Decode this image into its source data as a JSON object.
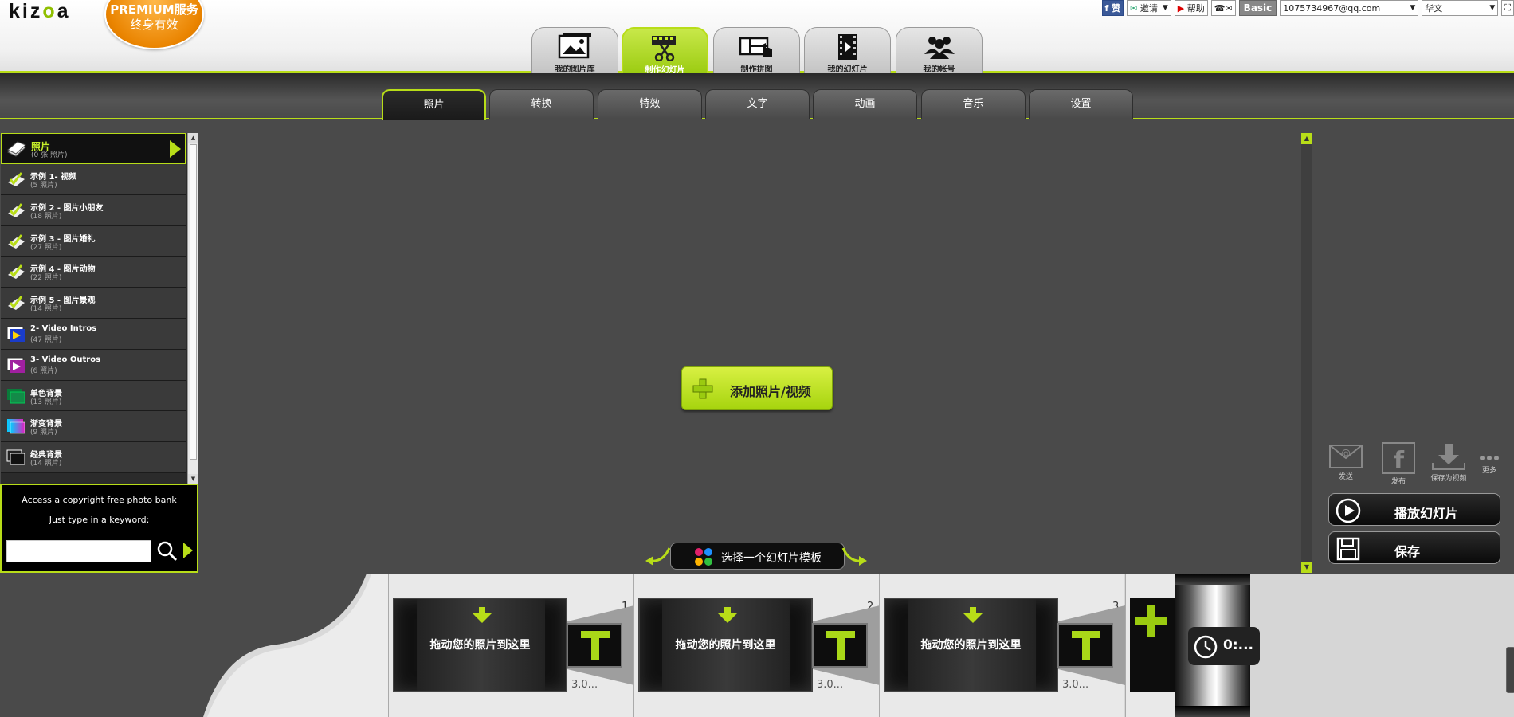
{
  "header": {
    "logo_text": "kizoa",
    "premium_line1": "PREMIUM服务",
    "premium_line2": "终身有效",
    "main_tabs": [
      {
        "label": "我的图片库"
      },
      {
        "label": "制作幻灯片",
        "active": true
      },
      {
        "label": "制作拼图"
      },
      {
        "label": "我的幻灯片"
      },
      {
        "label": "我的帐号"
      }
    ],
    "topright": {
      "fb_label": "赞",
      "invite_label": "邀请",
      "help_label": "帮助",
      "account_type": "Basic",
      "email": "1075734967@qq.com",
      "language": "华文"
    }
  },
  "sub_tabs": [
    "照片",
    "转换",
    "特效",
    "文字",
    "动画",
    "音乐",
    "设置"
  ],
  "left_panel": {
    "items": [
      {
        "name": "照片",
        "count": "(0 张 照片)",
        "icon": "photos-icon"
      },
      {
        "name": "示例 1- 视频",
        "count": "(5 照片)",
        "icon": "album-check-icon"
      },
      {
        "name": "示例 2 - 图片小朋友",
        "count": "(18 照片)",
        "icon": "album-check-icon"
      },
      {
        "name": "示例 3 - 图片婚礼",
        "count": "(27 照片)",
        "icon": "album-check-icon"
      },
      {
        "name": "示例 4 - 图片动物",
        "count": "(22 照片)",
        "icon": "album-check-icon"
      },
      {
        "name": "示例 5 - 图片景观",
        "count": "(14 照片)",
        "icon": "album-check-icon"
      },
      {
        "name": "2- Video Intros",
        "count": "(47 照片)",
        "icon": "video-intro-icon"
      },
      {
        "name": "3- Video Outros",
        "count": "(6 照片)",
        "icon": "video-outro-icon"
      },
      {
        "name": "单色背景",
        "count": "(13 照片)",
        "icon": "color-bg-icon"
      },
      {
        "name": "渐变背景",
        "count": "(9 照片)",
        "icon": "gradient-bg-icon"
      },
      {
        "name": "经典背景",
        "count": "(14 照片)",
        "icon": "classic-bg-icon"
      }
    ]
  },
  "photobank": {
    "title": "Access a copyright free photo bank",
    "hint": "Just type in a keyword:",
    "input_value": ""
  },
  "center": {
    "add_button": "添加照片/视频",
    "template_button": "选择一个幻灯片模板"
  },
  "right": {
    "share": [
      {
        "label": "发送",
        "icon": "email-icon"
      },
      {
        "label": "发布",
        "icon": "facebook-icon"
      },
      {
        "label": "保存为视频",
        "icon": "download-icon"
      },
      {
        "label": "更多",
        "icon": "more-icon"
      }
    ],
    "play_button": "播放幻灯片",
    "save_button": "保存"
  },
  "timeline": {
    "slots": [
      {
        "number": "1",
        "placeholder": "拖动您的照片到这里",
        "duration": "3.0..."
      },
      {
        "number": "2",
        "placeholder": "拖动您的照片到这里",
        "duration": "3.0..."
      },
      {
        "number": "3",
        "placeholder": "拖动您的照片到这里",
        "duration": "3.0..."
      }
    ],
    "total_time": "0:..."
  },
  "colors": {
    "accent": "#b8dd18",
    "premium": "#ea8400",
    "panel_bg": "#4a4a4a"
  }
}
